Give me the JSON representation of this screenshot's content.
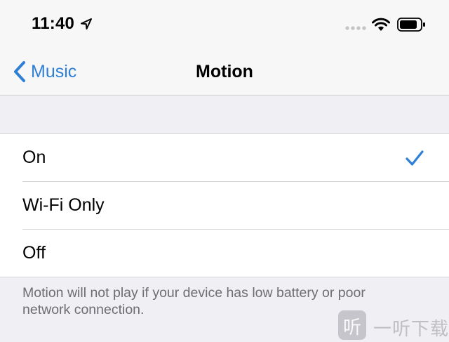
{
  "status_bar": {
    "time": "11:40",
    "icons": [
      "location-arrow-icon",
      "signal-icon",
      "wifi-icon",
      "battery-icon"
    ]
  },
  "nav": {
    "back_label": "Music",
    "title": "Motion"
  },
  "options": [
    {
      "label": "On",
      "selected": true
    },
    {
      "label": "Wi-Fi Only",
      "selected": false
    },
    {
      "label": "Off",
      "selected": false
    }
  ],
  "footer": {
    "text": "Motion will not play if your device has low battery or poor network connection."
  },
  "watermark": {
    "glyph": "听",
    "text": "一听下载"
  },
  "colors": {
    "accent": "#2f7fd6",
    "background": "#efeff4",
    "footer_text": "#6d6d72"
  }
}
